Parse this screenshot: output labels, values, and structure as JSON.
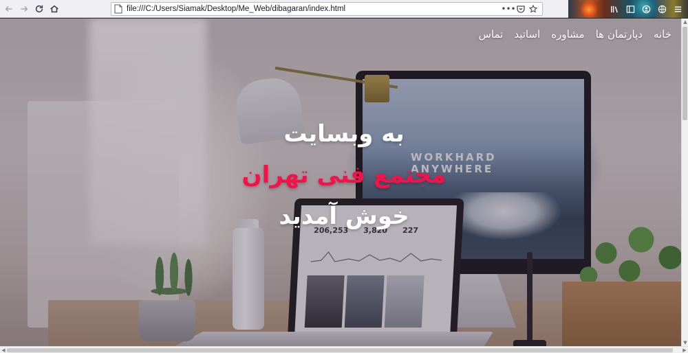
{
  "browser": {
    "url": "file:///C:/Users/Siamak/Desktop/Me_Web/dibagaran/index.html",
    "page_actions_icon": "ellipsis-icon",
    "pocket_icon": "pocket-icon",
    "bookmark_icon": "star-icon",
    "toolbar_icons": [
      "library-icon",
      "sidebar-icon",
      "account-icon",
      "globe-icon",
      "menu-icon"
    ]
  },
  "site": {
    "nav": [
      "خانه",
      "دپارتمان ها",
      "مشاوره",
      "اساتید",
      "تماس"
    ],
    "hero": {
      "line1": "به وبسایت",
      "line2": "مجتمع فنی تهران",
      "line3": "خوش آمدید"
    },
    "monitor_screen_text": [
      "WORKHARD",
      "ANYWHERE"
    ],
    "laptop_stats": [
      "206,253",
      "3,820",
      "227"
    ]
  },
  "colors": {
    "accent": "#f5124a",
    "hero_text": "#ffffff"
  }
}
